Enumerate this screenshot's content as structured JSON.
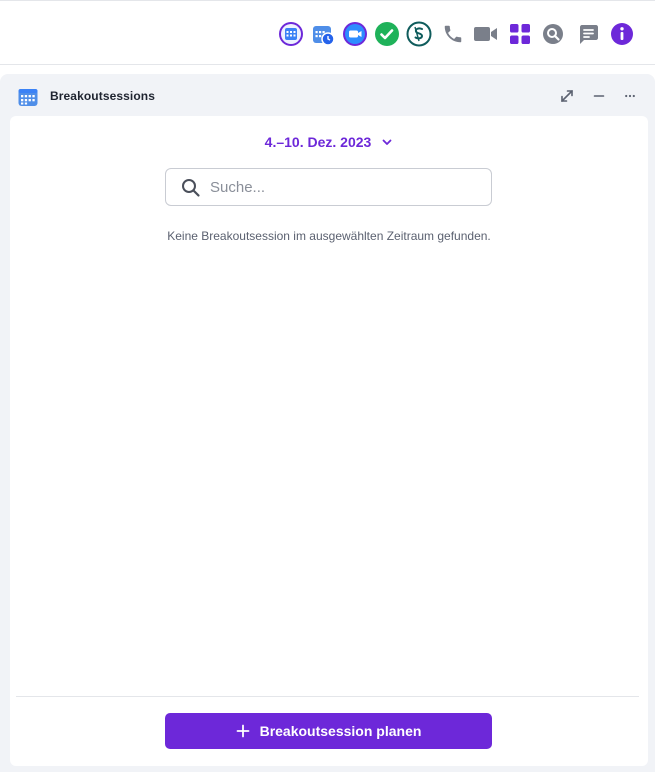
{
  "toolbar": {
    "icons": [
      "calendar-app-icon",
      "schedule-app-icon",
      "video-meeting-app-icon",
      "tasks-check-app-icon",
      "sketch-app-icon",
      "phone-icon",
      "video-camera-icon",
      "apps-grid-icon",
      "search-icon",
      "chat-icon",
      "info-icon"
    ]
  },
  "panel": {
    "title": "Breakoutsessions",
    "date_range": "4.–10. Dez. 2023",
    "search": {
      "placeholder": "Suche...",
      "value": ""
    },
    "empty_message": "Keine Breakoutsession im ausgewählten Zeitraum gefunden.",
    "primary_button_label": "Breakoutsession planen"
  },
  "colors": {
    "accent": "#6d28d9",
    "green": "#1fb25a",
    "teal": "#0f5c5c",
    "gray_icon": "#7a7f8a",
    "panel_bg": "#f1f3f7"
  }
}
